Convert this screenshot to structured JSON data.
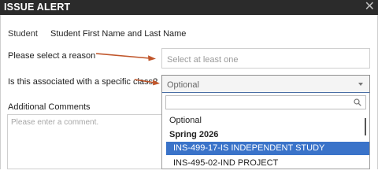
{
  "dialog": {
    "title": "ISSUE ALERT",
    "close_glyph": "✕"
  },
  "student": {
    "label": "Student",
    "value": "Student First Name and Last Name"
  },
  "reason": {
    "label": "Please select a reason",
    "placeholder": "Select at least one"
  },
  "class_field": {
    "label": "Is this associated with a specific class?",
    "selected": "Optional"
  },
  "comments": {
    "label": "Additional Comments",
    "placeholder": "Please enter a comment."
  },
  "dropdown": {
    "search_value": "",
    "options": [
      {
        "label": "Optional",
        "type": "option"
      },
      {
        "label": "Spring 2026",
        "type": "group"
      },
      {
        "label": "INS-499-17-IS INDEPENDENT STUDY",
        "type": "option",
        "highlighted": true
      },
      {
        "label": "INS-495-02-IND PROJECT",
        "type": "option"
      }
    ]
  },
  "colors": {
    "header_bg": "#2b2b2b",
    "highlight": "#3a73c9",
    "arrow": "#c0562b"
  },
  "icons": [
    "close-icon",
    "search-icon",
    "chevron-down-icon"
  ]
}
